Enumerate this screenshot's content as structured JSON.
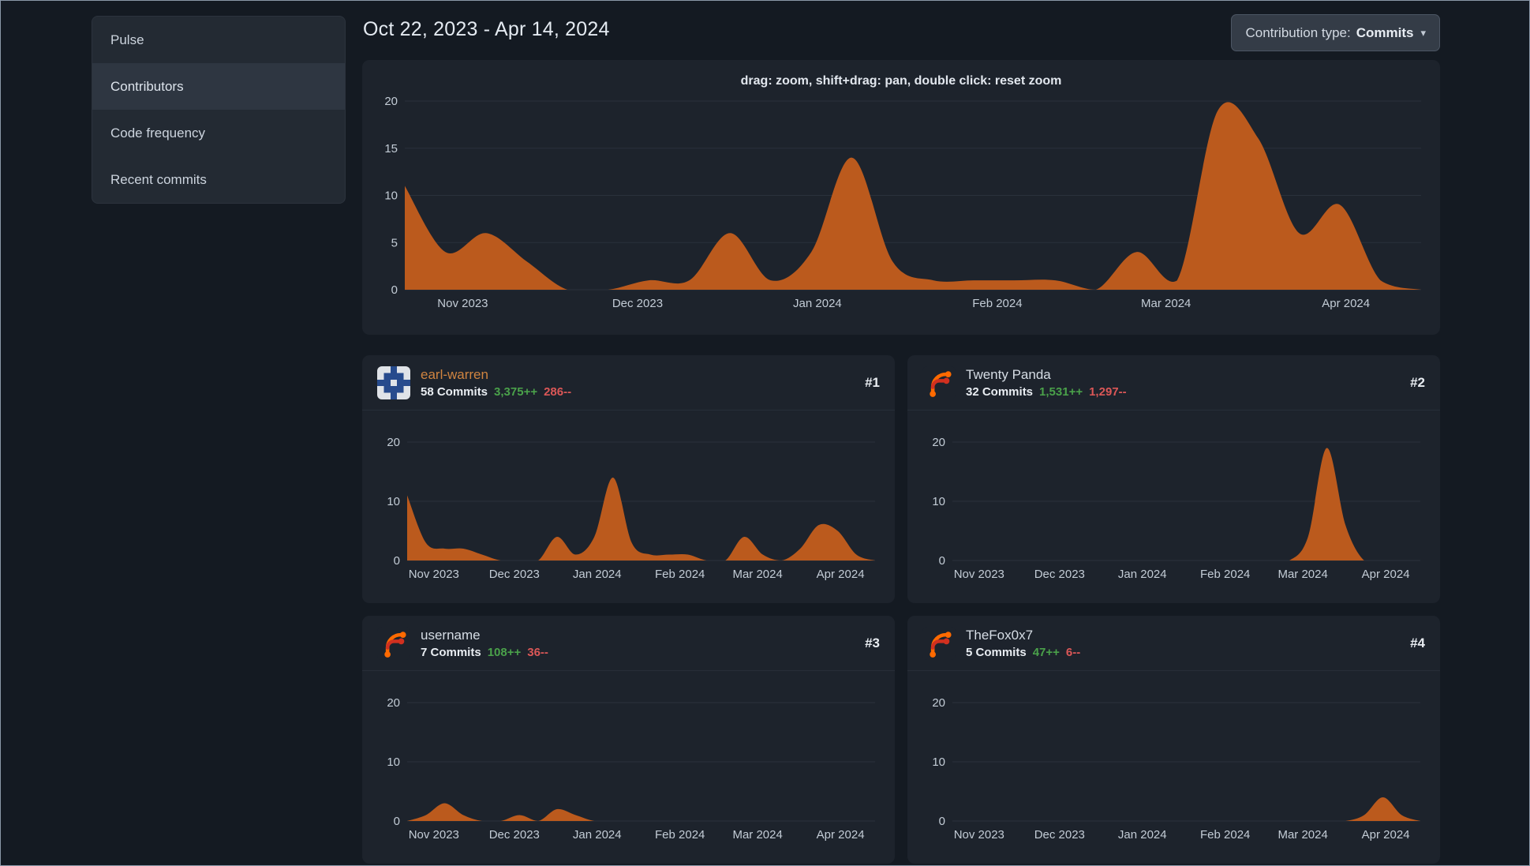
{
  "sidebar": {
    "items": [
      {
        "label": "Pulse"
      },
      {
        "label": "Contributors",
        "active": true
      },
      {
        "label": "Code frequency"
      },
      {
        "label": "Recent commits"
      }
    ]
  },
  "header": {
    "date_range": "Oct 22, 2023 - Apr 14, 2024",
    "contribution_type": {
      "label": "Contribution type:",
      "value": "Commits",
      "caret_icon": "▾"
    }
  },
  "colors": {
    "page_bg": "#141a22",
    "panel_bg": "#1d232c",
    "area_fill": "#bb5a1d",
    "additions": "#4aa14a",
    "deletions": "#db5757",
    "link_orange": "#d08440"
  },
  "contributors": [
    {
      "name": "earl-warren",
      "rank": "#1",
      "commits": "58 Commits",
      "additions": "3,375++",
      "deletions": "286--",
      "avatar": "identicon-avatar",
      "is_link": true
    },
    {
      "name": "Twenty Panda",
      "rank": "#2",
      "commits": "32 Commits",
      "additions": "1,531++",
      "deletions": "1,297--",
      "avatar": "forgejo-logo",
      "is_link": false
    },
    {
      "name": "username",
      "rank": "#3",
      "commits": "7 Commits",
      "additions": "108++",
      "deletions": "36--",
      "avatar": "forgejo-logo",
      "is_link": false
    },
    {
      "name": "TheFox0x7",
      "rank": "#4",
      "commits": "5 Commits",
      "additions": "47++",
      "deletions": "6--",
      "avatar": "forgejo-logo",
      "is_link": false
    }
  ],
  "chart_data": {
    "shared": {
      "type": "area",
      "x_unit": "week",
      "x_range": [
        "Oct 22, 2023",
        "Apr 14, 2024"
      ],
      "x_tick_labels": [
        "Nov 2023",
        "Dec 2023",
        "Jan 2024",
        "Feb 2024",
        "Mar 2024",
        "Apr 2024"
      ],
      "x_tick_fractions": [
        0.057,
        0.229,
        0.406,
        0.583,
        0.749,
        0.926
      ],
      "ylim": [
        0,
        20
      ],
      "grid": true,
      "legend": "none"
    },
    "charts": [
      {
        "id": "overall-commits",
        "hint": "drag: zoom, shift+drag: pan, double click: reset zoom",
        "yticks": [
          0,
          5,
          10,
          15,
          20
        ],
        "values": [
          11,
          4,
          6,
          3,
          0,
          0,
          1,
          1,
          6,
          1,
          4,
          14,
          3,
          1,
          1,
          1,
          1,
          0,
          4,
          1,
          19,
          16,
          6,
          9,
          1,
          0
        ]
      },
      {
        "id": "earl-warren-commits",
        "yticks": [
          0,
          10,
          20
        ],
        "values": [
          11,
          3,
          2,
          2,
          1,
          0,
          0,
          0,
          4,
          1,
          4,
          14,
          3,
          1,
          1,
          1,
          0,
          0,
          4,
          1,
          0,
          2,
          6,
          5,
          1,
          0
        ]
      },
      {
        "id": "twenty-panda-commits",
        "yticks": [
          0,
          10,
          20
        ],
        "values": [
          0,
          0,
          0,
          0,
          0,
          0,
          0,
          0,
          0,
          0,
          0,
          0,
          0,
          0,
          0,
          0,
          0,
          0,
          0,
          4,
          19,
          6,
          0,
          0,
          0,
          0
        ]
      },
      {
        "id": "username-commits",
        "yticks": [
          0,
          10,
          20
        ],
        "values": [
          0,
          1,
          3,
          1,
          0,
          0,
          1,
          0,
          2,
          1,
          0,
          0,
          0,
          0,
          0,
          0,
          0,
          0,
          0,
          0,
          0,
          0,
          0,
          0,
          0,
          0
        ]
      },
      {
        "id": "thefox0x7-commits",
        "yticks": [
          0,
          10,
          20
        ],
        "values": [
          0,
          0,
          0,
          0,
          0,
          0,
          0,
          0,
          0,
          0,
          0,
          0,
          0,
          0,
          0,
          0,
          0,
          0,
          0,
          0,
          0,
          0,
          1,
          4,
          1,
          0
        ]
      }
    ]
  }
}
